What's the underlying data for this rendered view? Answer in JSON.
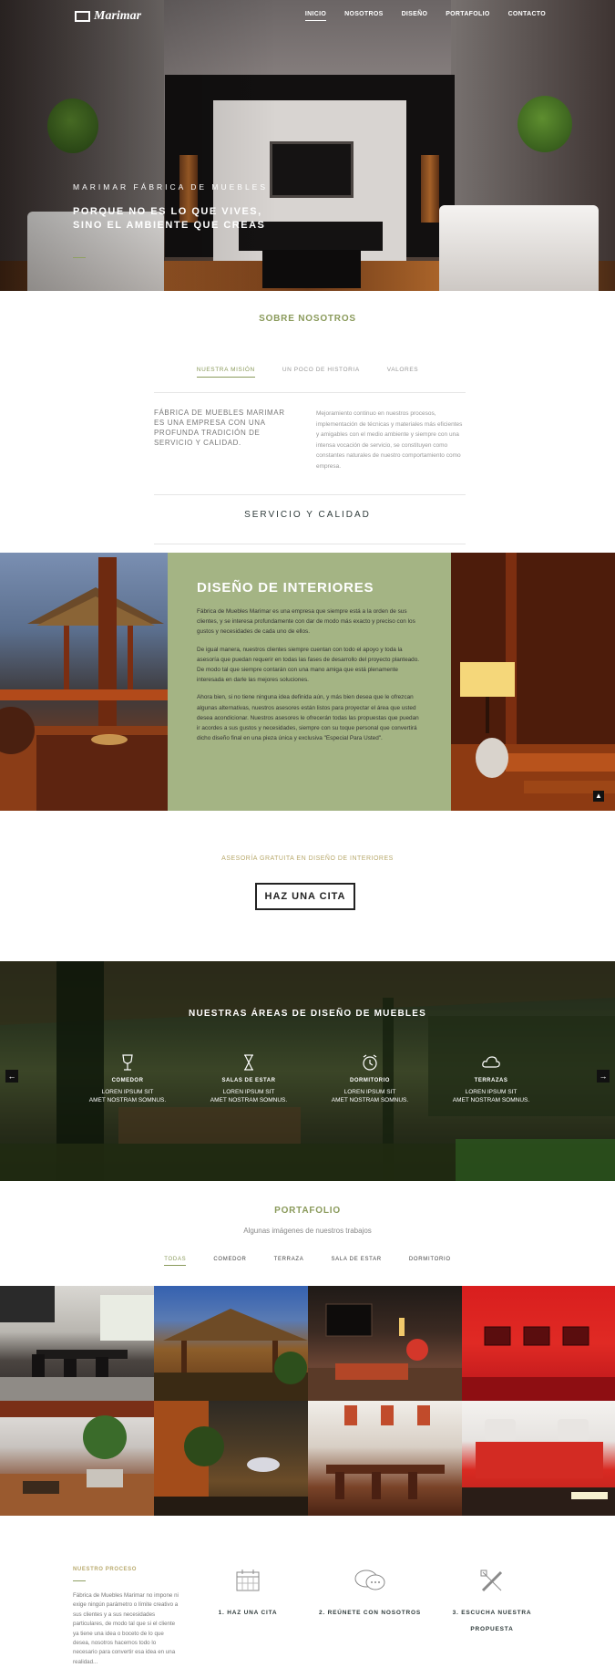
{
  "brand": {
    "name": "Marimar"
  },
  "nav": {
    "items": [
      "INICIO",
      "NOSOTROS",
      "DISEÑO",
      "PORTAFOLIO",
      "CONTACTO"
    ]
  },
  "hero": {
    "subtitle": "MARIMAR FÁBRICA DE MUEBLES",
    "title_line1": "PORQUE NO ES LO QUE VIVES,",
    "title_line2": "SINO EL AMBIENTE QUE CREAS"
  },
  "about": {
    "title": "SOBRE NOSOTROS",
    "tabs": [
      "NUESTRA MISIÓN",
      "UN POCO DE HISTORIA",
      "VALORES"
    ],
    "mission_heading": "FÁBRICA DE MUEBLES MARIMAR ES UNA EMPRESA CON UNA PROFUNDA TRADICIÓN DE SERVICIO Y CALIDAD.",
    "mission_text": "Mejoramiento continuo en nuestros procesos, implementación de técnicas y materiales más eficientes y amigables con el medio ambiente y siempre con una intensa vocación de servicio, se constituyen como constantes naturales de nuestro comportamiento como empresa.",
    "service": "SERVICIO Y CALIDAD"
  },
  "interior": {
    "title": "DISEÑO DE INTERIORES",
    "p1": "Fábrica de Muebles Marimar es una empresa que siempre está a la orden de sus clientes, y se interesa profundamente con dar de modo más exacto y preciso con los gustos y necesidades de cada uno de ellos.",
    "p2": "De igual manera, nuestros clientes siempre cuentan con todo el apoyo y toda la asesoría que puedan requerir en todas las fases de desarrollo del proyecto planteado. De modo tal que siempre contarán con una mano amiga que está plenamente interesada en darle las mejores soluciones.",
    "p3": "Ahora bien, si no tiene ninguna idea definida aún, y más bien desea que le ofrezcan algunas alternativas, nuestros asesores están listos para proyectar el área que usted desea acondicionar. Nuestros asesores le ofrecerán todas las propuestas que puedan ir acordes a sus gustos y necesidades, siempre con su toque personal que convertirá dicho diseño final en una pieza única y exclusiva \"Especial Para Usted\"."
  },
  "cita": {
    "subtitle": "ASESORÍA GRATUITA EN DISEÑO DE INTERIORES",
    "button": "HAZ UNA CITA"
  },
  "areas": {
    "title": "NUESTRAS ÁREAS DE DISEÑO DE MUEBLES",
    "items": [
      {
        "label": "COMEDOR",
        "line1": "LOREN IPSUM SIT",
        "line2": "AMET NOSTRAM SOMNUS.",
        "icon": "wine-glass-icon"
      },
      {
        "label": "SALAS DE ESTAR",
        "line1": "LOREN IPSUM SIT",
        "line2": "AMET NOSTRAM SOMNUS.",
        "icon": "hourglass-icon"
      },
      {
        "label": "DORMITORIO",
        "line1": "LOREN IPSUM SIT",
        "line2": "AMET NOSTRAM SOMNUS.",
        "icon": "alarm-clock-icon"
      },
      {
        "label": "TERRAZAS",
        "line1": "LOREN IPSUM SIT",
        "line2": "AMET NOSTRAM SOMNUS.",
        "icon": "cloud-icon"
      }
    ],
    "prev": "←",
    "next": "→"
  },
  "portfolio": {
    "title": "PORTAFOLIO",
    "subtitle": "Algunas imágenes de nuestros trabajos",
    "tabs": [
      "TODAS",
      "COMEDOR",
      "TERRAZA",
      "SALA DE ESTAR",
      "DORMITORIO"
    ]
  },
  "process": {
    "title": "NUESTRO PROCESO",
    "text": "Fábrica de Muebles Marimar no impone ni exige ningún parámetro o límite creativo a sus clientes y a sus necesidades particulares, de modo tal que si el cliente ya tiene una idea o boceto de lo que desea, nosotros hacemos todo lo necesario para convertir esa idea en una realidad...",
    "steps": [
      "1. HAZ UNA CITA",
      "2. REÚNETE CON NOSOTROS",
      "3. ESCUCHA NUESTRA PROPUESTA"
    ]
  },
  "colors": {
    "accent": "#8a9a5b",
    "green_box": "#a4b484",
    "gold": "#b9aa6e"
  }
}
